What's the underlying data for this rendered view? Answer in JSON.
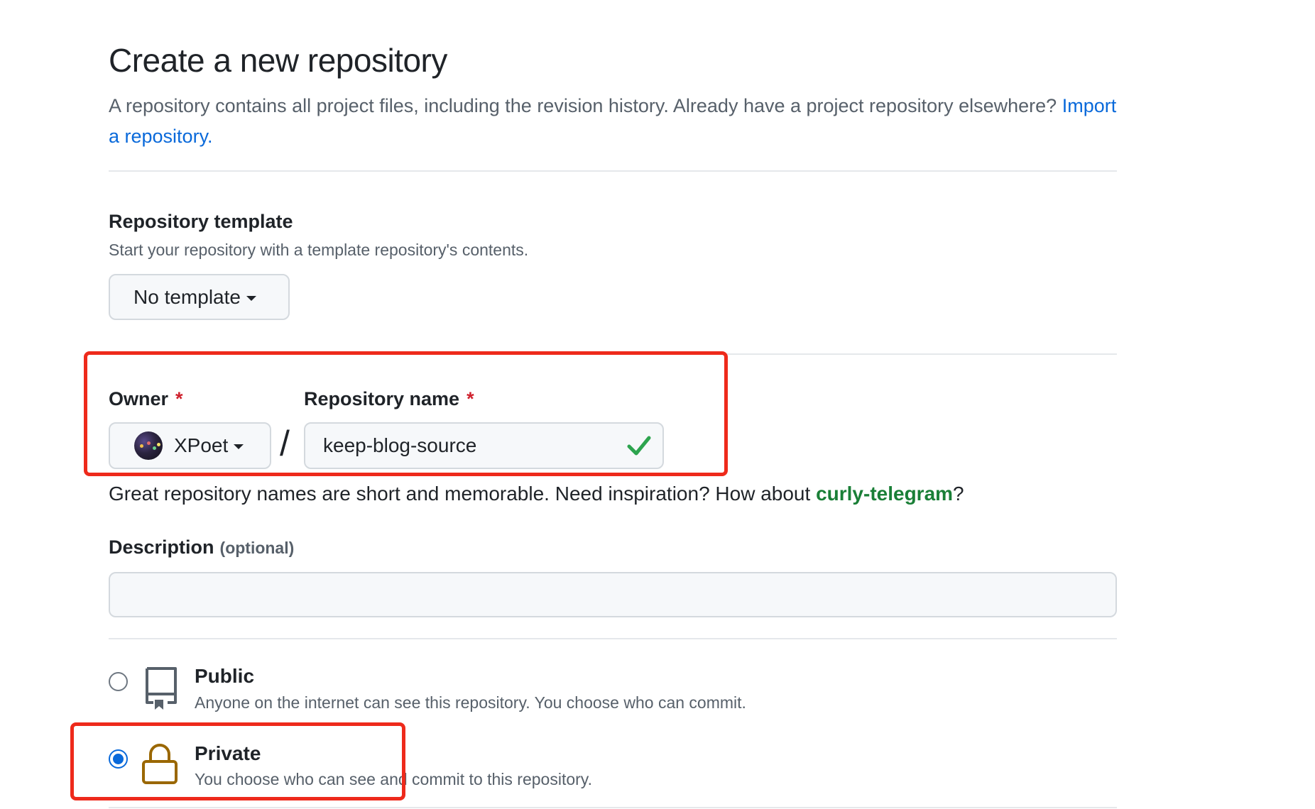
{
  "page": {
    "title": "Create a new repository",
    "subtitle": "A repository contains all project files, including the revision history. Already have a project repository elsewhere?",
    "import_link": "Import a repository."
  },
  "template": {
    "label": "Repository template",
    "note": "Start your repository with a template repository's contents.",
    "button": "No template"
  },
  "owner": {
    "label": "Owner",
    "required_mark": "*",
    "value": "XPoet"
  },
  "repo_name": {
    "label": "Repository name",
    "required_mark": "*",
    "value": "keep-blog-source"
  },
  "separator": "/",
  "hint": {
    "text": "Great repository names are short and memorable. Need inspiration? How about",
    "suggestion": "curly-telegram",
    "end": "?"
  },
  "description": {
    "label": "Description",
    "optional": "(optional)",
    "value": ""
  },
  "visibility": {
    "public": {
      "title": "Public",
      "note": "Anyone on the internet can see this repository. You choose who can commit.",
      "selected": false
    },
    "private": {
      "title": "Private",
      "note": "You choose who can see and commit to this repository.",
      "selected": true
    }
  },
  "colors": {
    "link": "#0969da",
    "success": "#1a7f37",
    "required": "#cf222e",
    "highlight": "#ee2a1b",
    "lock": "#9a6700"
  }
}
